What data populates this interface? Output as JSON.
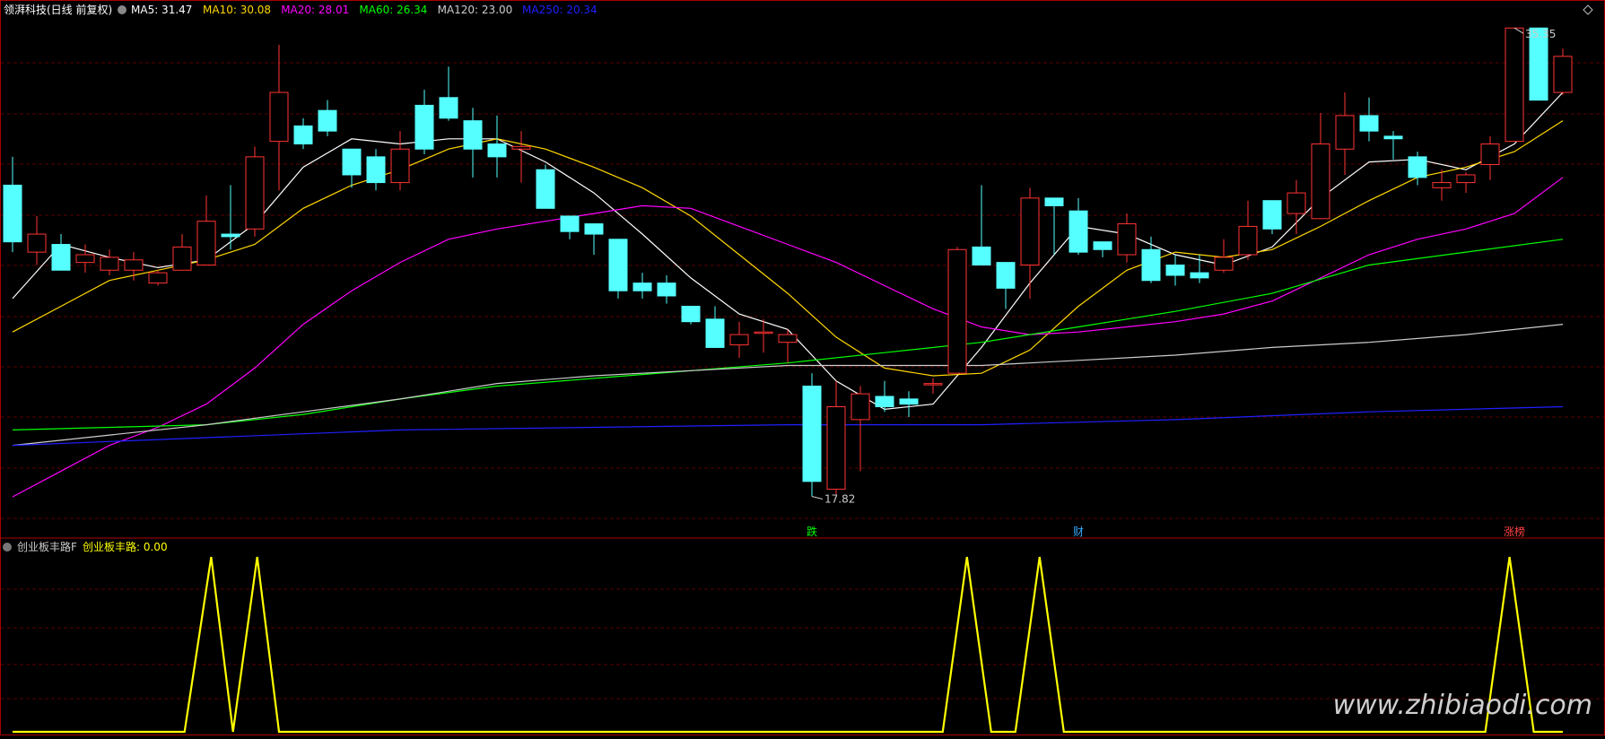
{
  "main_legend": {
    "title": "领湃科技(日线 前复权)",
    "items": [
      {
        "label": "MA5: 31.47",
        "color": "#ffffff"
      },
      {
        "label": "MA10: 30.08",
        "color": "#ffd700"
      },
      {
        "label": "MA20: 28.01",
        "color": "#ff00ff"
      },
      {
        "label": "MA60: 26.34",
        "color": "#00ff00"
      },
      {
        "label": "MA120: 23.00",
        "color": "#cccccc"
      },
      {
        "label": "MA250: 20.34",
        "color": "#2020ff"
      }
    ]
  },
  "sub_legend": {
    "title": "创业板丰路F",
    "value_label": "创业板丰路: 0.00"
  },
  "markers": [
    {
      "label": "跌",
      "color": "#00ff00",
      "bar_index": 33
    },
    {
      "label": "财",
      "color": "#33aaff",
      "bar_index": 44
    },
    {
      "label": "涨榜",
      "color": "#ff4040",
      "bar_index": 62
    }
  ],
  "watermark": "www.zhibiaodi.com",
  "colors": {
    "up": "#ff3333",
    "down": "#55ffff",
    "grid": "#5a0000",
    "border": "#aa0000",
    "indicator": "#ffff00"
  },
  "chart_data": {
    "type": "candlestick",
    "y_range": [
      16.2,
      36.6
    ],
    "price_labels": {
      "high": "35.35",
      "low": "17.82"
    },
    "bars": [
      [
        0,
        29.9,
        27.7,
        31.0,
        27.3
      ],
      [
        1,
        27.3,
        28.0,
        28.7,
        26.8
      ],
      [
        2,
        27.6,
        26.6,
        28.0,
        26.6
      ],
      [
        3,
        26.9,
        27.2,
        27.6,
        26.5
      ],
      [
        4,
        26.6,
        27.1,
        27.4,
        26.4
      ],
      [
        5,
        26.6,
        27.0,
        27.3,
        26.2
      ],
      [
        6,
        26.1,
        26.5,
        26.6,
        26.0
      ],
      [
        7,
        26.6,
        27.5,
        28.0,
        26.6
      ],
      [
        8,
        26.8,
        28.5,
        29.5,
        26.8
      ],
      [
        9,
        28.0,
        27.9,
        29.9,
        27.4
      ],
      [
        10,
        28.2,
        31.0,
        31.4,
        27.9
      ],
      [
        11,
        31.6,
        33.5,
        35.35,
        29.7
      ],
      [
        12,
        32.2,
        31.5,
        32.5,
        31.3
      ],
      [
        13,
        32.8,
        32.0,
        33.2,
        31.8
      ],
      [
        14,
        31.3,
        30.3,
        31.3,
        29.8
      ],
      [
        15,
        31.0,
        30.0,
        31.3,
        29.7
      ],
      [
        16,
        30.0,
        31.3,
        32.0,
        29.7
      ],
      [
        17,
        33.0,
        31.3,
        33.6,
        31.1
      ],
      [
        18,
        33.3,
        32.5,
        34.5,
        32.4
      ],
      [
        19,
        32.4,
        31.3,
        32.9,
        30.2
      ],
      [
        20,
        31.5,
        31.0,
        32.6,
        30.2
      ],
      [
        21,
        31.3,
        31.4,
        32.0,
        30.0
      ],
      [
        22,
        30.5,
        29.0,
        30.7,
        29.0
      ],
      [
        23,
        28.7,
        28.1,
        28.7,
        27.8
      ],
      [
        24,
        28.4,
        28.0,
        28.4,
        27.2
      ],
      [
        25,
        27.8,
        25.8,
        27.8,
        25.5
      ],
      [
        26,
        26.1,
        25.8,
        26.5,
        25.5
      ],
      [
        27,
        26.1,
        25.6,
        26.4,
        25.3
      ],
      [
        28,
        25.2,
        24.6,
        25.2,
        24.5
      ],
      [
        29,
        24.7,
        23.6,
        25.2,
        23.6
      ],
      [
        30,
        23.7,
        24.1,
        24.6,
        23.2
      ],
      [
        31,
        24.2,
        24.2,
        24.7,
        23.4
      ],
      [
        32,
        23.8,
        24.1,
        24.3,
        23.0
      ],
      [
        33,
        22.1,
        18.4,
        22.6,
        17.82
      ],
      [
        34,
        18.1,
        21.3,
        22.3,
        17.9
      ],
      [
        35,
        20.8,
        21.8,
        22.1,
        18.8
      ],
      [
        36,
        21.7,
        21.3,
        22.3,
        21.1
      ],
      [
        37,
        21.6,
        21.4,
        21.9,
        20.9
      ],
      [
        38,
        22.2,
        22.2,
        22.4,
        21.8
      ],
      [
        39,
        22.6,
        27.4,
        27.5,
        22.6
      ],
      [
        40,
        27.5,
        26.8,
        29.9,
        26.8
      ],
      [
        41,
        26.9,
        25.9,
        26.9,
        25.1
      ],
      [
        42,
        26.8,
        29.4,
        29.8,
        25.5
      ],
      [
        43,
        29.4,
        29.1,
        29.4,
        27.2
      ],
      [
        44,
        28.9,
        27.3,
        29.4,
        27.2
      ],
      [
        45,
        27.7,
        27.4,
        27.7,
        27.1
      ],
      [
        46,
        27.2,
        28.4,
        28.8,
        26.9
      ],
      [
        47,
        27.4,
        26.2,
        27.9,
        26.1
      ],
      [
        48,
        26.8,
        26.4,
        27.2,
        26.0
      ],
      [
        49,
        26.5,
        26.3,
        27.2,
        26.1
      ],
      [
        50,
        26.6,
        27.1,
        27.8,
        26.5
      ],
      [
        51,
        27.2,
        28.3,
        29.3,
        27.0
      ],
      [
        52,
        29.3,
        28.2,
        29.3,
        28.0
      ],
      [
        53,
        28.8,
        29.6,
        30.1,
        28.0
      ],
      [
        54,
        28.6,
        31.5,
        32.7,
        28.6
      ],
      [
        55,
        31.3,
        32.6,
        33.5,
        30.3
      ],
      [
        56,
        32.6,
        32.0,
        33.3,
        31.6
      ],
      [
        57,
        31.8,
        31.7,
        32.0,
        30.9
      ],
      [
        58,
        31.0,
        30.2,
        31.2,
        29.9
      ],
      [
        59,
        29.8,
        30.0,
        30.5,
        29.3
      ],
      [
        60,
        30.0,
        30.3,
        30.4,
        29.6
      ],
      [
        61,
        30.7,
        31.5,
        31.8,
        30.1
      ],
      [
        62,
        31.6,
        36.0,
        36.0,
        31.6
      ],
      [
        63,
        36.0,
        33.2,
        36.0,
        33.2
      ],
      [
        64,
        33.5,
        34.9,
        35.2,
        33.4
      ]
    ],
    "ma_lines": [
      {
        "name": "MA5",
        "color": "#ffffff",
        "points": [
          [
            0,
            25.5
          ],
          [
            2,
            27.6
          ],
          [
            4,
            27.1
          ],
          [
            6,
            26.7
          ],
          [
            8,
            27.0
          ],
          [
            10,
            28.4
          ],
          [
            12,
            30.6
          ],
          [
            14,
            31.7
          ],
          [
            16,
            31.5
          ],
          [
            18,
            31.7
          ],
          [
            20,
            31.7
          ],
          [
            22,
            30.8
          ],
          [
            24,
            29.6
          ],
          [
            26,
            28.0
          ],
          [
            28,
            26.3
          ],
          [
            30,
            24.9
          ],
          [
            32,
            24.3
          ],
          [
            34,
            22.3
          ],
          [
            36,
            21.2
          ],
          [
            38,
            21.4
          ],
          [
            40,
            23.6
          ],
          [
            42,
            26.1
          ],
          [
            44,
            28.3
          ],
          [
            46,
            28.0
          ],
          [
            48,
            27.2
          ],
          [
            50,
            26.8
          ],
          [
            52,
            27.5
          ],
          [
            54,
            29.4
          ],
          [
            56,
            30.8
          ],
          [
            58,
            30.9
          ],
          [
            60,
            30.5
          ],
          [
            62,
            31.5
          ],
          [
            64,
            33.5
          ]
        ]
      },
      {
        "name": "MA10",
        "color": "#ffd700",
        "points": [
          [
            0,
            24.2
          ],
          [
            2,
            25.2
          ],
          [
            4,
            26.2
          ],
          [
            6,
            26.6
          ],
          [
            8,
            27.0
          ],
          [
            10,
            27.6
          ],
          [
            12,
            29.0
          ],
          [
            14,
            29.9
          ],
          [
            16,
            30.5
          ],
          [
            18,
            31.3
          ],
          [
            20,
            31.7
          ],
          [
            22,
            31.3
          ],
          [
            24,
            30.6
          ],
          [
            26,
            29.8
          ],
          [
            28,
            28.7
          ],
          [
            30,
            27.2
          ],
          [
            32,
            25.7
          ],
          [
            34,
            24.0
          ],
          [
            36,
            22.8
          ],
          [
            38,
            22.5
          ],
          [
            40,
            22.6
          ],
          [
            42,
            23.5
          ],
          [
            44,
            25.2
          ],
          [
            46,
            26.6
          ],
          [
            48,
            27.3
          ],
          [
            50,
            27.1
          ],
          [
            52,
            27.4
          ],
          [
            54,
            28.3
          ],
          [
            56,
            29.3
          ],
          [
            58,
            30.2
          ],
          [
            60,
            30.6
          ],
          [
            62,
            31.2
          ],
          [
            64,
            32.4
          ]
        ]
      },
      {
        "name": "MA20",
        "color": "#ff00ff",
        "points": [
          [
            0,
            17.8
          ],
          [
            2,
            18.8
          ],
          [
            4,
            19.8
          ],
          [
            6,
            20.5
          ],
          [
            8,
            21.4
          ],
          [
            10,
            22.8
          ],
          [
            12,
            24.5
          ],
          [
            14,
            25.8
          ],
          [
            16,
            26.9
          ],
          [
            18,
            27.8
          ],
          [
            20,
            28.2
          ],
          [
            22,
            28.5
          ],
          [
            24,
            28.8
          ],
          [
            26,
            29.1
          ],
          [
            28,
            29.0
          ],
          [
            30,
            28.3
          ],
          [
            32,
            27.6
          ],
          [
            34,
            26.9
          ],
          [
            36,
            26.0
          ],
          [
            38,
            25.1
          ],
          [
            40,
            24.4
          ],
          [
            42,
            24.1
          ],
          [
            44,
            24.2
          ],
          [
            46,
            24.4
          ],
          [
            48,
            24.6
          ],
          [
            50,
            24.9
          ],
          [
            52,
            25.4
          ],
          [
            54,
            26.3
          ],
          [
            56,
            27.2
          ],
          [
            58,
            27.8
          ],
          [
            60,
            28.2
          ],
          [
            62,
            28.8
          ],
          [
            64,
            30.2
          ]
        ]
      },
      {
        "name": "MA60",
        "color": "#00ff00",
        "points": [
          [
            0,
            20.4
          ],
          [
            4,
            20.5
          ],
          [
            8,
            20.6
          ],
          [
            12,
            21.0
          ],
          [
            16,
            21.6
          ],
          [
            20,
            22.1
          ],
          [
            24,
            22.4
          ],
          [
            28,
            22.7
          ],
          [
            32,
            23.0
          ],
          [
            36,
            23.4
          ],
          [
            40,
            23.8
          ],
          [
            44,
            24.4
          ],
          [
            48,
            25.0
          ],
          [
            52,
            25.7
          ],
          [
            56,
            26.8
          ],
          [
            60,
            27.3
          ],
          [
            64,
            27.8
          ]
        ]
      },
      {
        "name": "MA120",
        "color": "#cccccc",
        "points": [
          [
            0,
            19.8
          ],
          [
            4,
            20.2
          ],
          [
            8,
            20.6
          ],
          [
            12,
            21.1
          ],
          [
            16,
            21.6
          ],
          [
            20,
            22.2
          ],
          [
            24,
            22.5
          ],
          [
            28,
            22.7
          ],
          [
            32,
            22.9
          ],
          [
            36,
            22.9
          ],
          [
            40,
            22.9
          ],
          [
            44,
            23.1
          ],
          [
            48,
            23.3
          ],
          [
            52,
            23.6
          ],
          [
            56,
            23.8
          ],
          [
            60,
            24.1
          ],
          [
            64,
            24.5
          ]
        ]
      },
      {
        "name": "MA250",
        "color": "#2020ff",
        "points": [
          [
            0,
            19.8
          ],
          [
            8,
            20.1
          ],
          [
            16,
            20.4
          ],
          [
            24,
            20.5
          ],
          [
            32,
            20.6
          ],
          [
            40,
            20.6
          ],
          [
            48,
            20.8
          ],
          [
            56,
            21.1
          ],
          [
            64,
            21.3
          ]
        ]
      }
    ],
    "indicator": {
      "name": "创业板丰路",
      "y_range": [
        0,
        1
      ],
      "points": [
        [
          0,
          0
        ],
        [
          7.1,
          0
        ],
        [
          8.2,
          1
        ],
        [
          9.1,
          0
        ],
        [
          9.1,
          0
        ],
        [
          10.1,
          1
        ],
        [
          11.0,
          0
        ],
        [
          38.4,
          0
        ],
        [
          39.4,
          1
        ],
        [
          40.4,
          0
        ],
        [
          41.4,
          0
        ],
        [
          42.4,
          1
        ],
        [
          43.4,
          0
        ],
        [
          60.8,
          0
        ],
        [
          61.8,
          1
        ],
        [
          62.8,
          0
        ],
        [
          64,
          0
        ]
      ]
    }
  }
}
